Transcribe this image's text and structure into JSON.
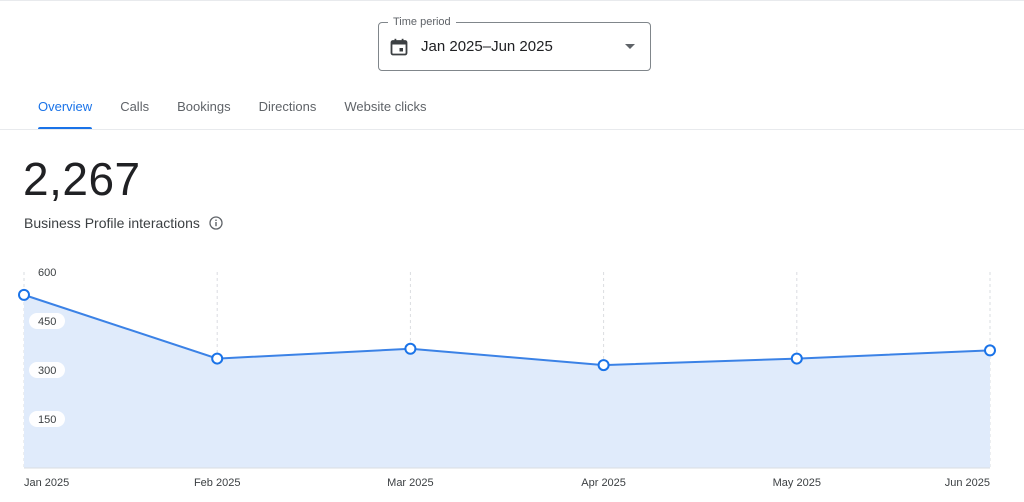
{
  "time_period": {
    "legend": "Time period",
    "value": "Jan 2025–Jun 2025",
    "calendar_icon": "calendar-icon",
    "caret_icon": "chevron-down-icon"
  },
  "tabs": [
    {
      "label": "Overview",
      "active": true
    },
    {
      "label": "Calls",
      "active": false
    },
    {
      "label": "Bookings",
      "active": false
    },
    {
      "label": "Directions",
      "active": false
    },
    {
      "label": "Website clicks",
      "active": false
    }
  ],
  "summary": {
    "total": "2,267",
    "label": "Business Profile interactions",
    "info_icon": "info-icon"
  },
  "colors": {
    "accent": "#1a73e8",
    "area_fill": "#e0ebfb",
    "line": "#3b82e6"
  },
  "chart_data": {
    "type": "area",
    "categories": [
      "Jan 2025",
      "Feb 2025",
      "Mar 2025",
      "Apr 2025",
      "May 2025",
      "Jun 2025"
    ],
    "values": [
      530,
      335,
      365,
      315,
      335,
      360
    ],
    "yticks": [
      150,
      300,
      450,
      600
    ],
    "ylim": [
      0,
      600
    ],
    "grid": "vertical-dashed"
  }
}
